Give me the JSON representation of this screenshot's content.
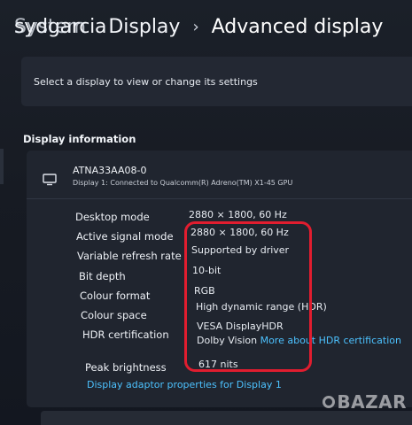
{
  "header": {
    "overlap_text_a": "System",
    "overlap_text_b": "sydgarcia",
    "parent": "Display",
    "separator": "›",
    "current": "Advanced display"
  },
  "select_display": {
    "label": "Select a display to view or change its settings"
  },
  "display_information": {
    "heading": "Display information",
    "monitor_name": "ATNA33AA08-0",
    "monitor_sub": "Display 1: Connected to Qualcomm(R) Adreno(TM) X1-45 GPU",
    "rows": [
      {
        "label": "Desktop mode",
        "value": "2880 × 1800, 60 Hz"
      },
      {
        "label": "Active signal mode",
        "value": "2880 × 1800, 60 Hz"
      },
      {
        "label": "Variable refresh rate",
        "value": "Supported by driver"
      },
      {
        "label": "Bit depth",
        "value": "10-bit"
      },
      {
        "label": "Colour format",
        "value": "RGB"
      },
      {
        "label": "Colour space",
        "value": "High dynamic range (HDR)"
      },
      {
        "label": "HDR certification",
        "value": "VESA DisplayHDR",
        "value2": "Dolby Vision",
        "link": "More about HDR certification"
      },
      {
        "label": "Peak brightness",
        "value": "617 nits"
      }
    ],
    "adapter_link": "Display adaptor properties for Display 1"
  },
  "watermark": {
    "text": "BAZAR"
  },
  "colors": {
    "background": "#171b23",
    "card": "#20252f",
    "link": "#4cc2ff",
    "highlight": "#e11d2f"
  }
}
